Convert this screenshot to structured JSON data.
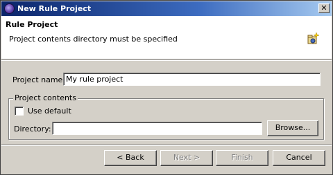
{
  "window": {
    "title": "New Rule Project",
    "close_label": "✕"
  },
  "header": {
    "title": "Rule Project",
    "message": "Project contents directory must be specified"
  },
  "form": {
    "project_name_label": "Project name:",
    "project_name_value": "My rule project",
    "group_label": "Project contents",
    "use_default_label": "Use default",
    "use_default_checked": false,
    "directory_label": "Directory:",
    "directory_value": "",
    "browse_label": "Browse..."
  },
  "buttons": {
    "back": "< Back",
    "next": "Next >",
    "finish": "Finish",
    "cancel": "Cancel"
  }
}
